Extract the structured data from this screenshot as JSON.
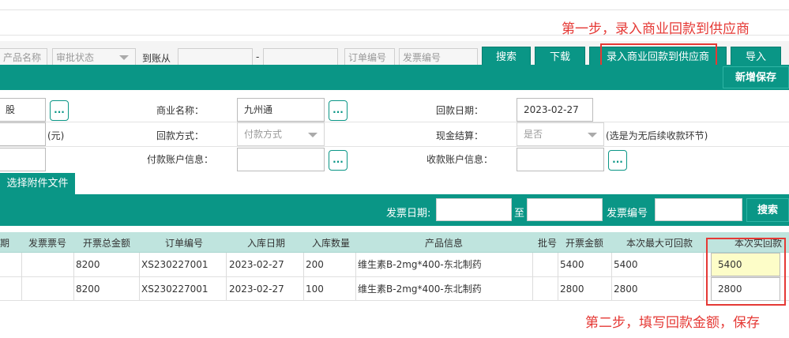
{
  "annotations": {
    "step1": "第一步，录入商业回款到供应商",
    "step2": "第二步，填写回款金额，保存"
  },
  "toolbar": {
    "product_name_placeholder": "产品名称",
    "approval_status": "审批状态",
    "arrival_label": "到账从",
    "range_dash": "-",
    "order_no_placeholder": "订单编号",
    "invoice_no_placeholder": "发票编号",
    "search_label": "搜索",
    "download_label": "下载",
    "record_label": "录入商业回款到供应商",
    "import_label": "导入"
  },
  "green_bar": {
    "new_save_label": "新增保存"
  },
  "form": {
    "row1": {
      "left_value": "股",
      "business_name_label": "商业名称：",
      "business_name_value": "九州通",
      "payback_date_label": "回款日期：",
      "payback_date_value": "2023-02-27"
    },
    "row2": {
      "unit": "(元)",
      "payback_method_label": "回款方式：",
      "payback_method_value": "付款方式",
      "cash_settle_label": "现金结算：",
      "cash_settle_value": "是否",
      "cash_settle_note": "(选是为无后续收款环节)"
    },
    "row3": {
      "payer_account_label": "付款账户信息：",
      "payee_account_label": "收款账户信息："
    },
    "dots": "..."
  },
  "attach": {
    "label": "选择附件文件"
  },
  "filter": {
    "invoice_date_label": "发票日期:",
    "to_label": "至",
    "invoice_no_label": "发票编号",
    "search_label": "搜索"
  },
  "table": {
    "headers": [
      "期",
      "发票票号",
      "开票总金额",
      "订单编号",
      "入库日期",
      "入库数量",
      "产品信息",
      "批号",
      "开票金额",
      "本次最大可回款",
      "本次实回款"
    ],
    "rows": [
      {
        "total": "8200",
        "order_no": "XS230227001",
        "in_date": "2023-02-27",
        "qty": "200",
        "product": "维生素B-2mg*400-东北制药",
        "invoice_amt": "5400",
        "max_payback": "5400",
        "actual_payback": "5400"
      },
      {
        "total": "8200",
        "order_no": "XS230227001",
        "in_date": "2023-02-27",
        "qty": "100",
        "product": "维生素B-2mg*400-东北制药",
        "invoice_amt": "2800",
        "max_payback": "2800",
        "actual_payback": "2800"
      }
    ]
  },
  "colors": {
    "teal": "#0a9686",
    "annotation_red": "#e53935",
    "highlight_input": "#fdfdc8"
  }
}
